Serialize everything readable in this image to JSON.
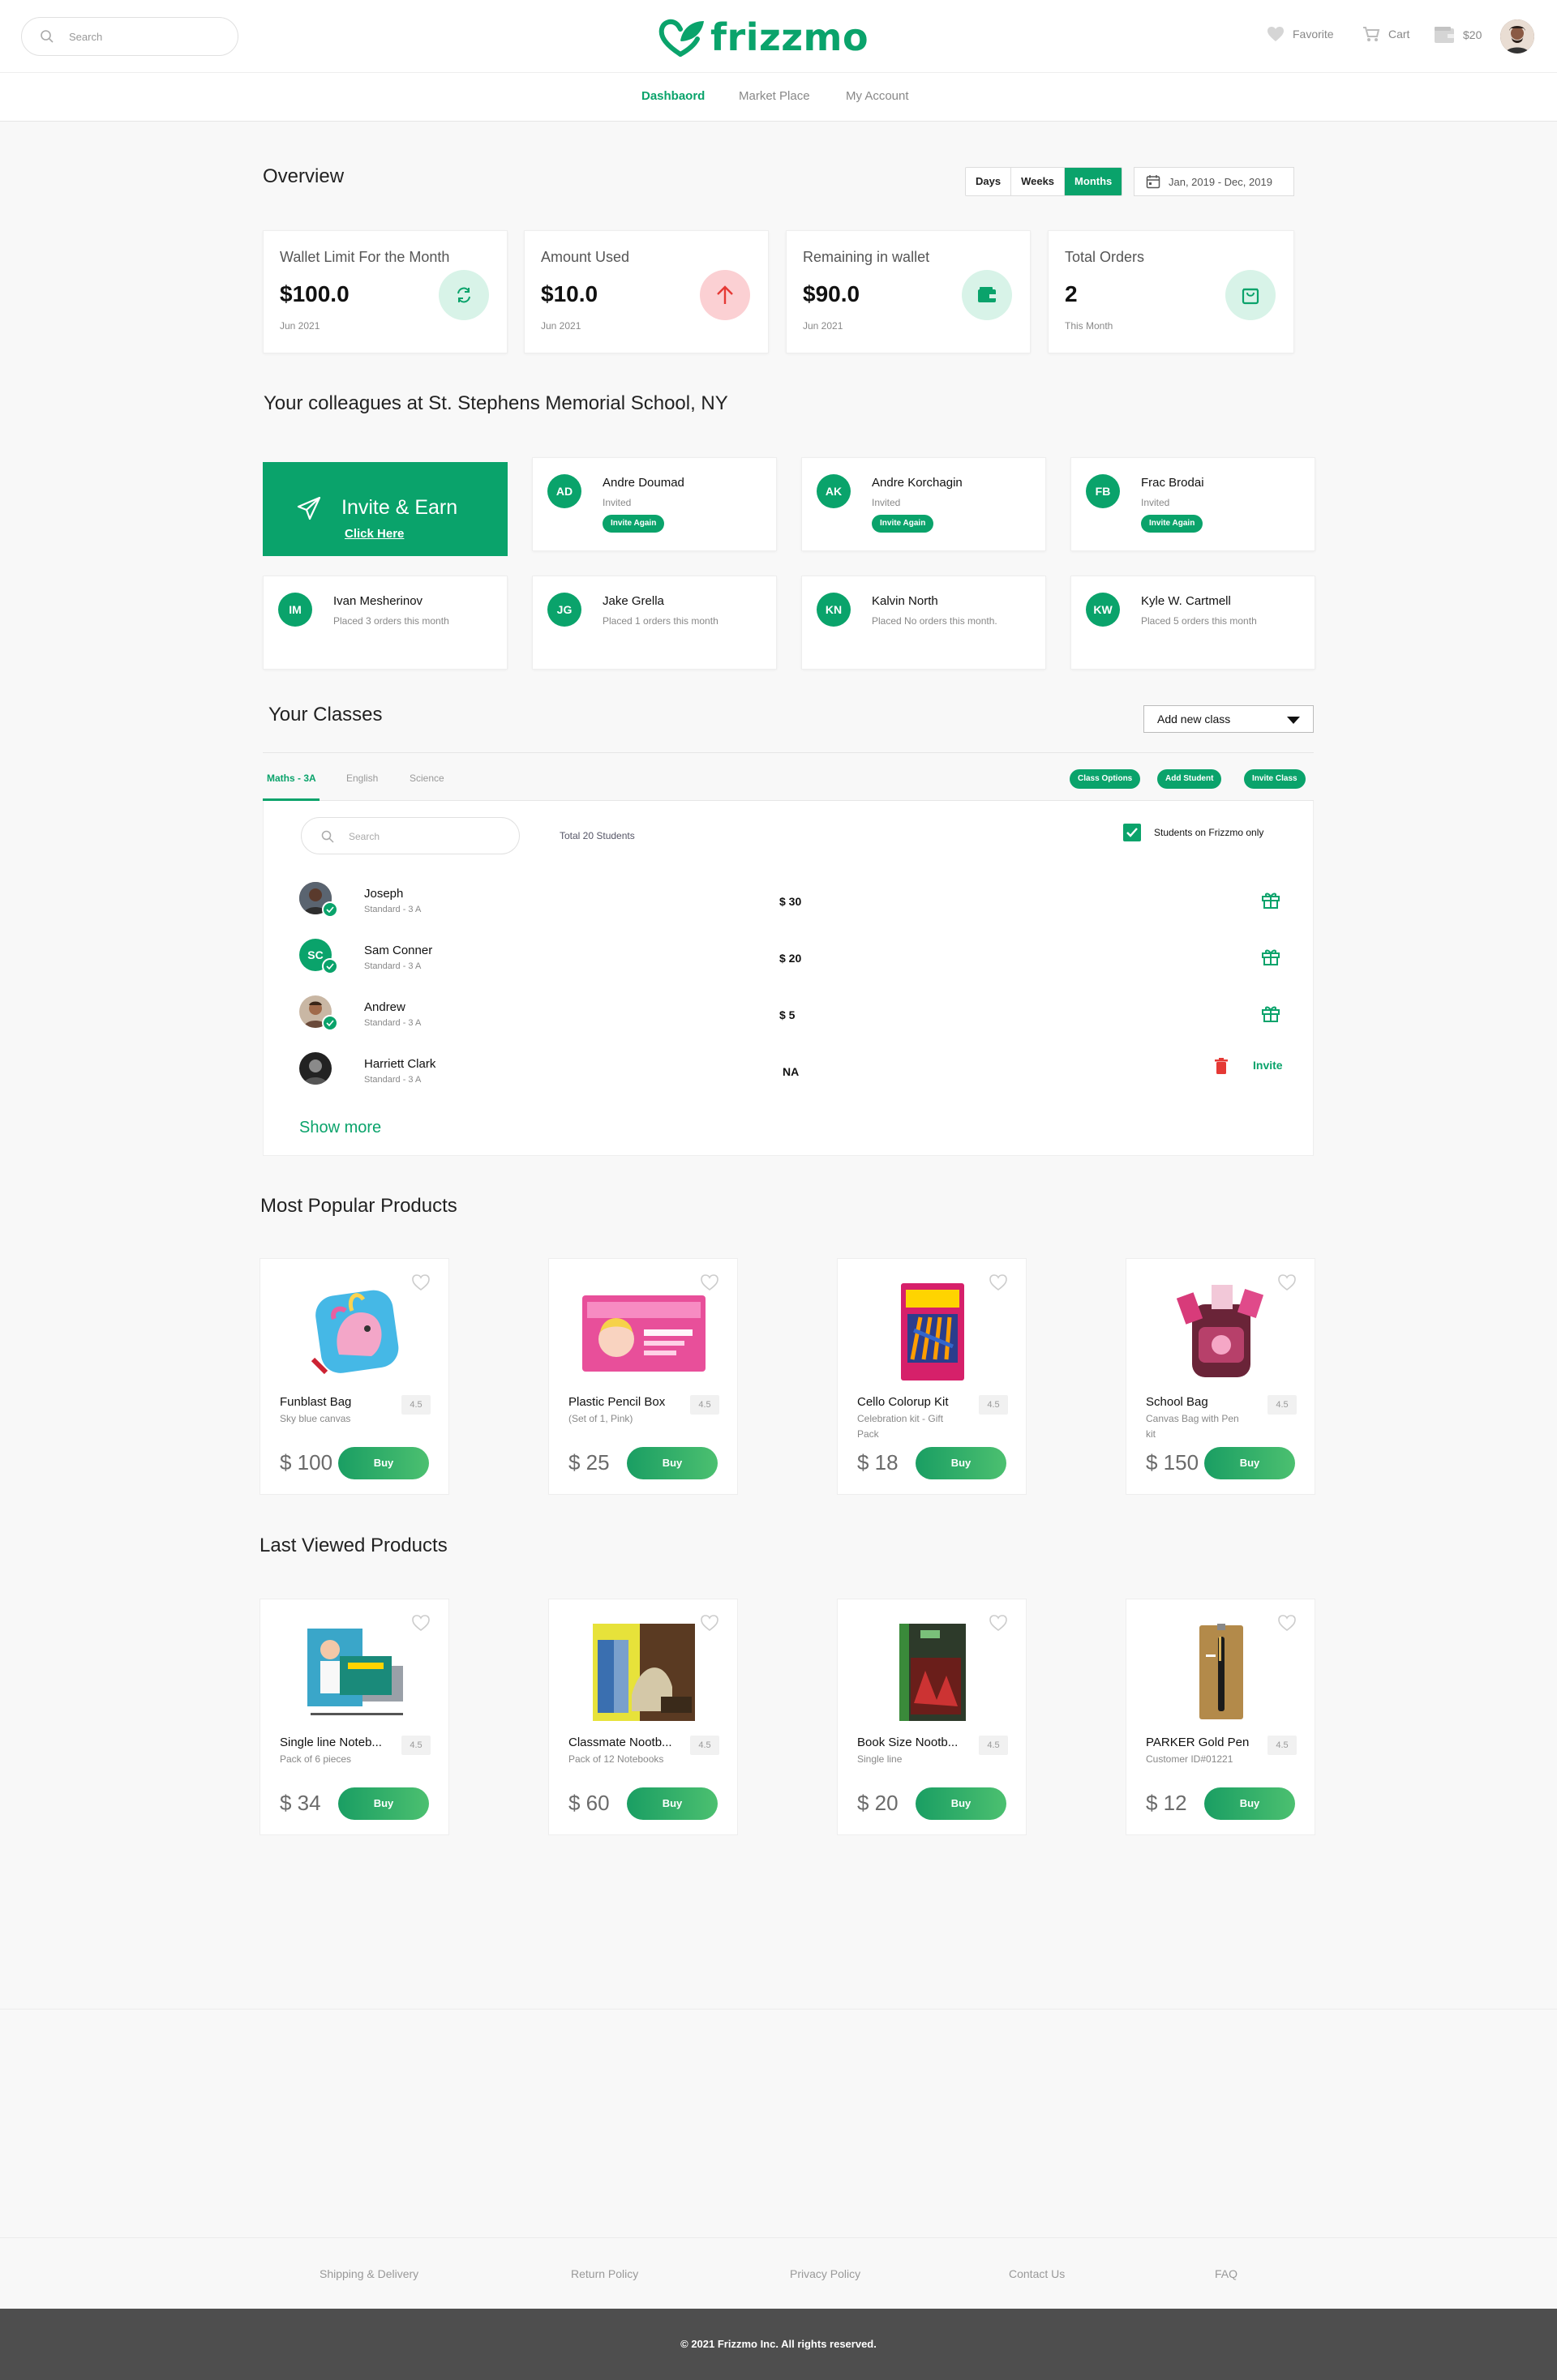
{
  "header": {
    "search_placeholder": "Search",
    "logo": "frizzmo",
    "favorite_label": "Favorite",
    "cart_label": "Cart",
    "wallet_amount": "$20"
  },
  "nav": {
    "items": [
      "Dashbaord",
      "Market Place",
      "My Account"
    ],
    "active": "Dashbaord"
  },
  "overview": {
    "title": "Overview",
    "period_tabs": [
      "Days",
      "Weeks",
      "Months"
    ],
    "active_period": "Months",
    "date_range": "Jan, 2019 - Dec, 2019",
    "stats": [
      {
        "label": "Wallet Limit For the Month",
        "value": "$100.0",
        "sub": "Jun 2021",
        "icon": "refresh-icon",
        "color": "#d8f3e8"
      },
      {
        "label": "Amount Used",
        "value": "$10.0",
        "sub": "Jun 2021",
        "icon": "arrow-up-icon",
        "color": "#fbd0d3"
      },
      {
        "label": "Remaining in wallet",
        "value": "$90.0",
        "sub": "Jun 2021",
        "icon": "wallet-icon",
        "color": "#d8f3e8"
      },
      {
        "label": "Total Orders",
        "value": "2",
        "sub": "This Month",
        "icon": "shopping-bag-icon",
        "color": "#d8f3e8"
      }
    ]
  },
  "colleagues": {
    "title": "Your colleagues at St. Stephens Memorial School, NY",
    "invite_title": "Invite & Earn",
    "invite_link": "Click Here",
    "invited": [
      {
        "initials": "AD",
        "name": "Andre Doumad",
        "status": "Invited",
        "action": "Invite Again"
      },
      {
        "initials": "AK",
        "name": "Andre Korchagin",
        "status": "Invited",
        "action": "Invite Again"
      },
      {
        "initials": "FB",
        "name": "Frac Brodai",
        "status": "Invited",
        "action": "Invite Again"
      }
    ],
    "active": [
      {
        "initials": "IM",
        "name": "Ivan Mesherinov",
        "status": "Placed 3 orders this  month"
      },
      {
        "initials": "JG",
        "name": "Jake Grella",
        "status": "Placed 1 orders this  month"
      },
      {
        "initials": "KN",
        "name": "Kalvin North",
        "status": "Placed No orders this month."
      },
      {
        "initials": "KW",
        "name": "Kyle W. Cartmell",
        "status": "Placed 5 orders this  month"
      }
    ]
  },
  "classes": {
    "title": "Your Classes",
    "add_class_label": "Add new class",
    "tabs": [
      "Maths - 3A",
      "English",
      "Science"
    ],
    "active_tab": "Maths - 3A",
    "actions": [
      "Class Options",
      "Add Student",
      "Invite Class"
    ],
    "search_placeholder": "Search",
    "total": "Total 20 Students",
    "filter_label": "Students on Frizzmo only",
    "filter_checked": true,
    "students": [
      {
        "name": "Joseph",
        "class": "Standard - 3 A",
        "amount": "$ 30",
        "action": "gift"
      },
      {
        "name": "Sam Conner",
        "initials": "SC",
        "class": "Standard - 3 A",
        "amount": "$ 20",
        "action": "gift"
      },
      {
        "name": "Andrew",
        "class": "Standard - 3 A",
        "amount": "$ 5",
        "action": "gift"
      },
      {
        "name": "Harriett Clark",
        "class": "Standard - 3 A",
        "amount": "NA",
        "action": "Invite"
      }
    ],
    "show_more": "Show more"
  },
  "popular": {
    "title": "Most Popular Products",
    "items": [
      {
        "name": "Funblast Bag",
        "desc": "Sky blue canvas",
        "rating": "4.5",
        "price": "$ 100",
        "buy": "Buy"
      },
      {
        "name": "Plastic Pencil Box",
        "desc": "(Set of 1, Pink)",
        "rating": "4.5",
        "price": "$ 25",
        "buy": "Buy"
      },
      {
        "name": "Cello Colorup Kit",
        "desc": "Celebration kit - Gift Pack",
        "rating": "4.5",
        "price": "$ 18",
        "buy": "Buy"
      },
      {
        "name": "School Bag",
        "desc": "Canvas Bag with Pen kit",
        "rating": "4.5",
        "price": "$ 150",
        "buy": "Buy"
      }
    ]
  },
  "last_viewed": {
    "title": "Last Viewed Products",
    "items": [
      {
        "name": "Single line Noteb...",
        "desc": "Pack of 6 pieces",
        "rating": "4.5",
        "price": "$ 34",
        "buy": "Buy"
      },
      {
        "name": "Classmate Nootb...",
        "desc": "Pack of 12 Notebooks",
        "rating": "4.5",
        "price": "$ 60",
        "buy": "Buy"
      },
      {
        "name": "Book Size Nootb...",
        "desc": "Single line",
        "rating": "4.5",
        "price": "$ 20",
        "buy": "Buy"
      },
      {
        "name": "PARKER Gold Pen",
        "desc": "Customer ID#01221",
        "rating": "4.5",
        "price": "$ 12",
        "buy": "Buy"
      }
    ]
  },
  "footer": {
    "links": [
      "Shipping & Delivery",
      "Return Policy",
      "Privacy Policy",
      "Contact Us",
      "FAQ"
    ],
    "copyright": "© 2021 Frizzmo Inc. All rights reserved."
  },
  "colors": {
    "accent": "#0aa36b",
    "danger": "#e53935"
  }
}
